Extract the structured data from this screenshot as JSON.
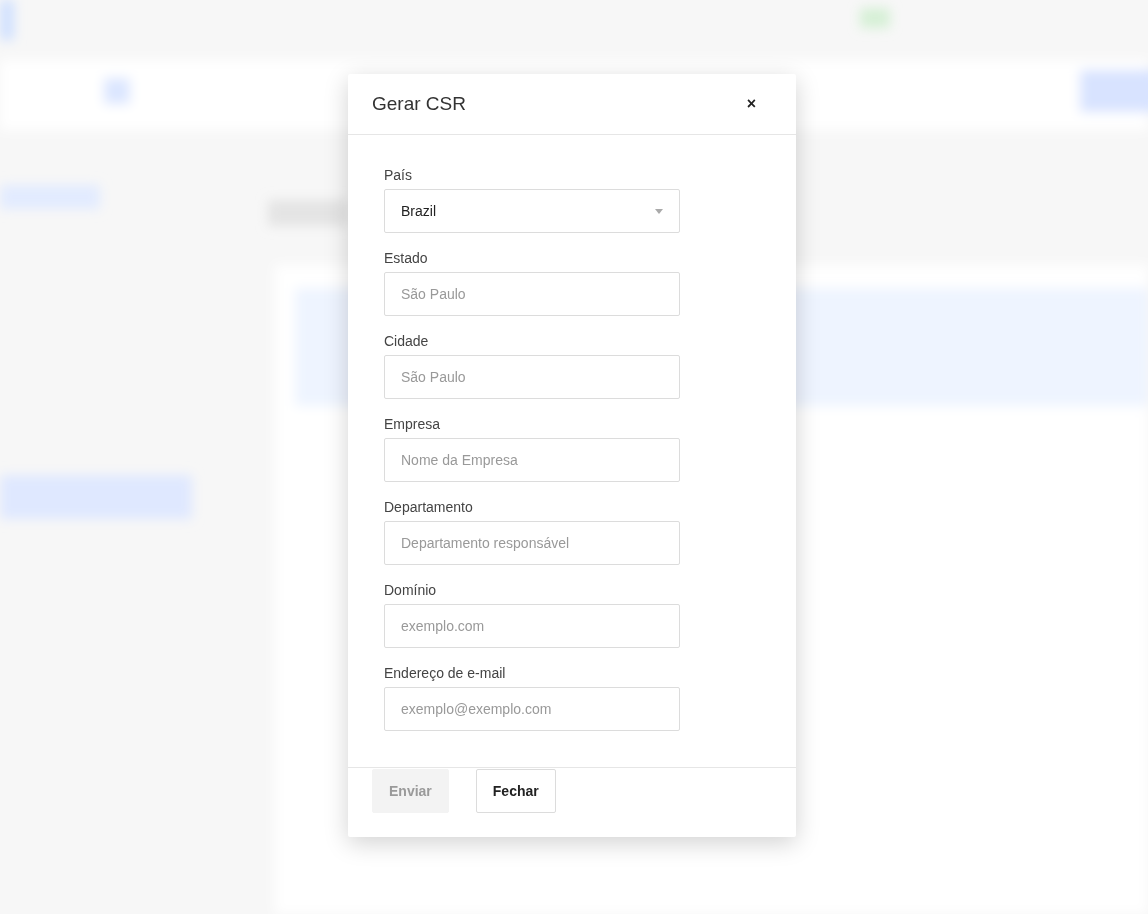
{
  "modal": {
    "title": "Gerar CSR",
    "close": "×",
    "fields": [
      {
        "label": "País",
        "kind": "select",
        "value": "Brazil"
      },
      {
        "label": "Estado",
        "kind": "input",
        "placeholder": "São Paulo"
      },
      {
        "label": "Cidade",
        "kind": "input",
        "placeholder": "São Paulo"
      },
      {
        "label": "Empresa",
        "kind": "input",
        "placeholder": "Nome da Empresa"
      },
      {
        "label": "Departamento",
        "kind": "input",
        "placeholder": "Departamento responsável"
      },
      {
        "label": "Domínio",
        "kind": "input",
        "placeholder": "exemplo.com"
      },
      {
        "label": "Endereço de e-mail",
        "kind": "input",
        "placeholder": "exemplo@exemplo.com"
      }
    ],
    "buttons": [
      {
        "label": "Enviar",
        "disabled": true
      },
      {
        "label": "Fechar",
        "disabled": false
      }
    ]
  }
}
